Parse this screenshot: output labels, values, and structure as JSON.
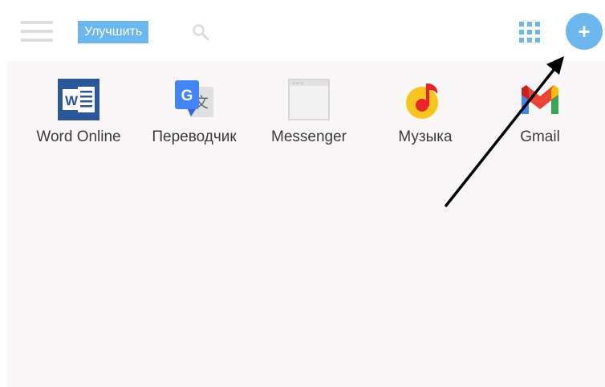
{
  "header": {
    "upgrade_label": "Улучшить",
    "icons": [
      "menu-icon",
      "search-icon",
      "apps-grid-icon",
      "plus-icon"
    ],
    "add_label": "+"
  },
  "apps": [
    {
      "label": "Word Online",
      "icon": "word-icon"
    },
    {
      "label": "Переводчик",
      "icon": "translate-icon"
    },
    {
      "label": "Messenger",
      "icon": "messenger-icon"
    },
    {
      "label": "Музыка",
      "icon": "music-icon"
    },
    {
      "label": "Gmail",
      "icon": "gmail-icon"
    }
  ],
  "colors": {
    "accent": "#6bb6ec",
    "panel_background": "#f8f6f7",
    "label_text": "#3c3c3c",
    "word_blue": "#2b579a",
    "music_yellow": "#f7c51e",
    "music_red": "#e8242e",
    "arrow": "#000000"
  }
}
